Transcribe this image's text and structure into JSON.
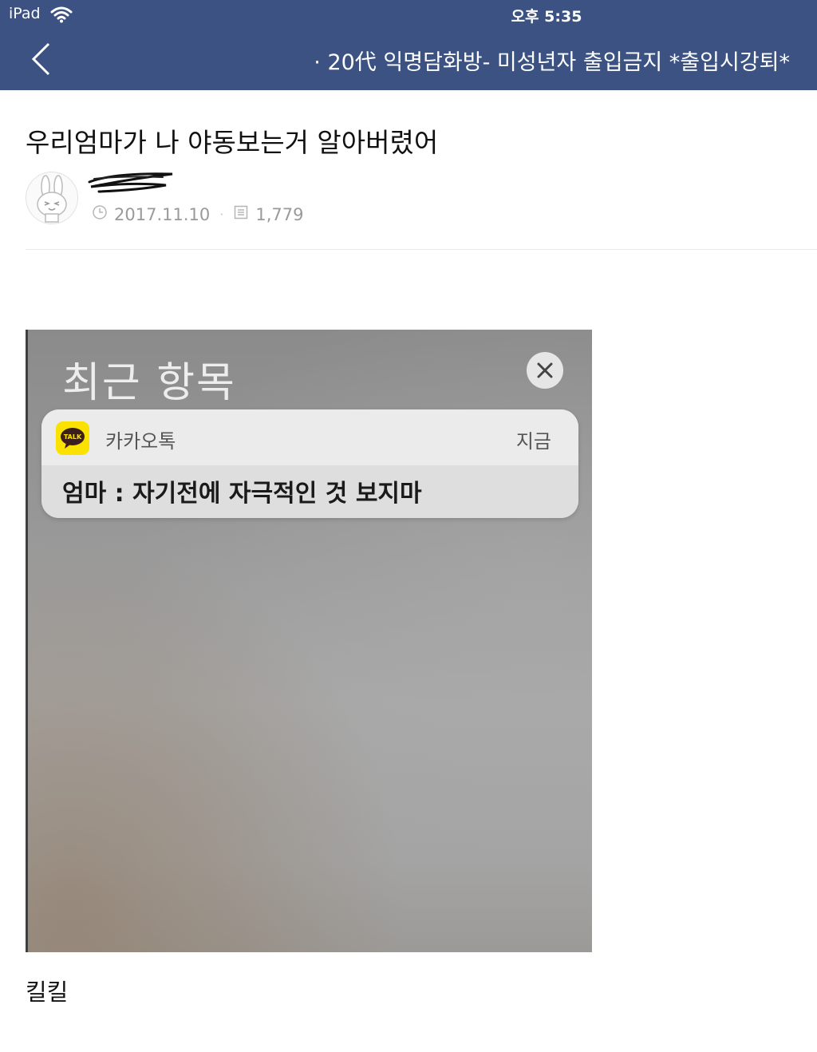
{
  "status_bar": {
    "device": "iPad",
    "time": "오후 5:35"
  },
  "header": {
    "title": "· 20代 익명담화방- 미성년자 출입금지 *출입시강퇴*",
    "bar_color": "#3b5283"
  },
  "post": {
    "title": "우리엄마가 나 야동보는거 알아버렸어",
    "date": "2017.11.10",
    "views": "1,779",
    "body_text": "킬킬"
  },
  "screenshot_image": {
    "heading": "최근 항목",
    "notification": {
      "app_name": "카카오톡",
      "time": "지금",
      "message": "엄마 : 자기전에 자극적인 것 보지마",
      "icon_label": "TALK",
      "icon_color": "#fae100"
    }
  },
  "icons": [
    "back-icon",
    "wifi-icon",
    "clock-icon",
    "view-count-icon",
    "close-icon",
    "kakaotalk-icon",
    "bunny-avatar-icon"
  ]
}
